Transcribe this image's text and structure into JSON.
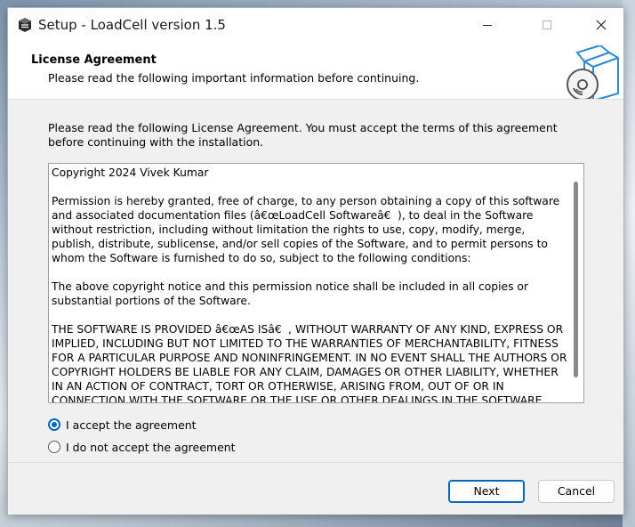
{
  "window": {
    "title": "Setup - LoadCell version 1.5",
    "app_icon": "installer-icon",
    "controls": [
      "minimize-icon",
      "maximize-icon",
      "close-icon"
    ]
  },
  "header": {
    "title": "License Agreement",
    "subtitle": "Please read the following important information before continuing.",
    "graphic": "setup-box-disc-icon"
  },
  "body": {
    "instruction": "Please read the following License Agreement. You must accept the terms of this agreement before continuing with the installation.",
    "license_text": "Copyright 2024 Vivek Kumar\n\nPermission is hereby granted, free of charge, to any person obtaining a copy of this software and associated documentation files (â€œLoadCell Softwareâ€), to deal in the Software without restriction, including without limitation the rights to use, copy, modify, merge, publish, distribute, sublicense, and/or sell copies of the Software, and to permit persons to whom the Software is furnished to do so, subject to the following conditions:\n\nThe above copyright notice and this permission notice shall be included in all copies or substantial portions of the Software.\n\nTHE SOFTWARE IS PROVIDED â€œAS ISâ€, WITHOUT WARRANTY OF ANY KIND, EXPRESS OR IMPLIED, INCLUDING BUT NOT LIMITED TO THE WARRANTIES OF MERCHANTABILITY, FITNESS FOR A PARTICULAR PURPOSE AND NONINFRINGEMENT. IN NO EVENT SHALL THE AUTHORS OR COPYRIGHT HOLDERS BE LIABLE FOR ANY CLAIM, DAMAGES OR OTHER LIABILITY, WHETHER IN AN ACTION OF CONTRACT, TORT OR OTHERWISE, ARISING FROM, OUT OF OR IN CONNECTION WITH THE SOFTWARE OR THE USE OR OTHER DEALINGS IN THE SOFTWARE.",
    "options": [
      {
        "label": "I accept the agreement",
        "selected": true
      },
      {
        "label": "I do not accept the agreement",
        "selected": false
      }
    ]
  },
  "footer": {
    "next_label": "Next",
    "cancel_label": "Cancel"
  },
  "colors": {
    "accent": "#0067c0",
    "panel": "#f0f0f0"
  }
}
